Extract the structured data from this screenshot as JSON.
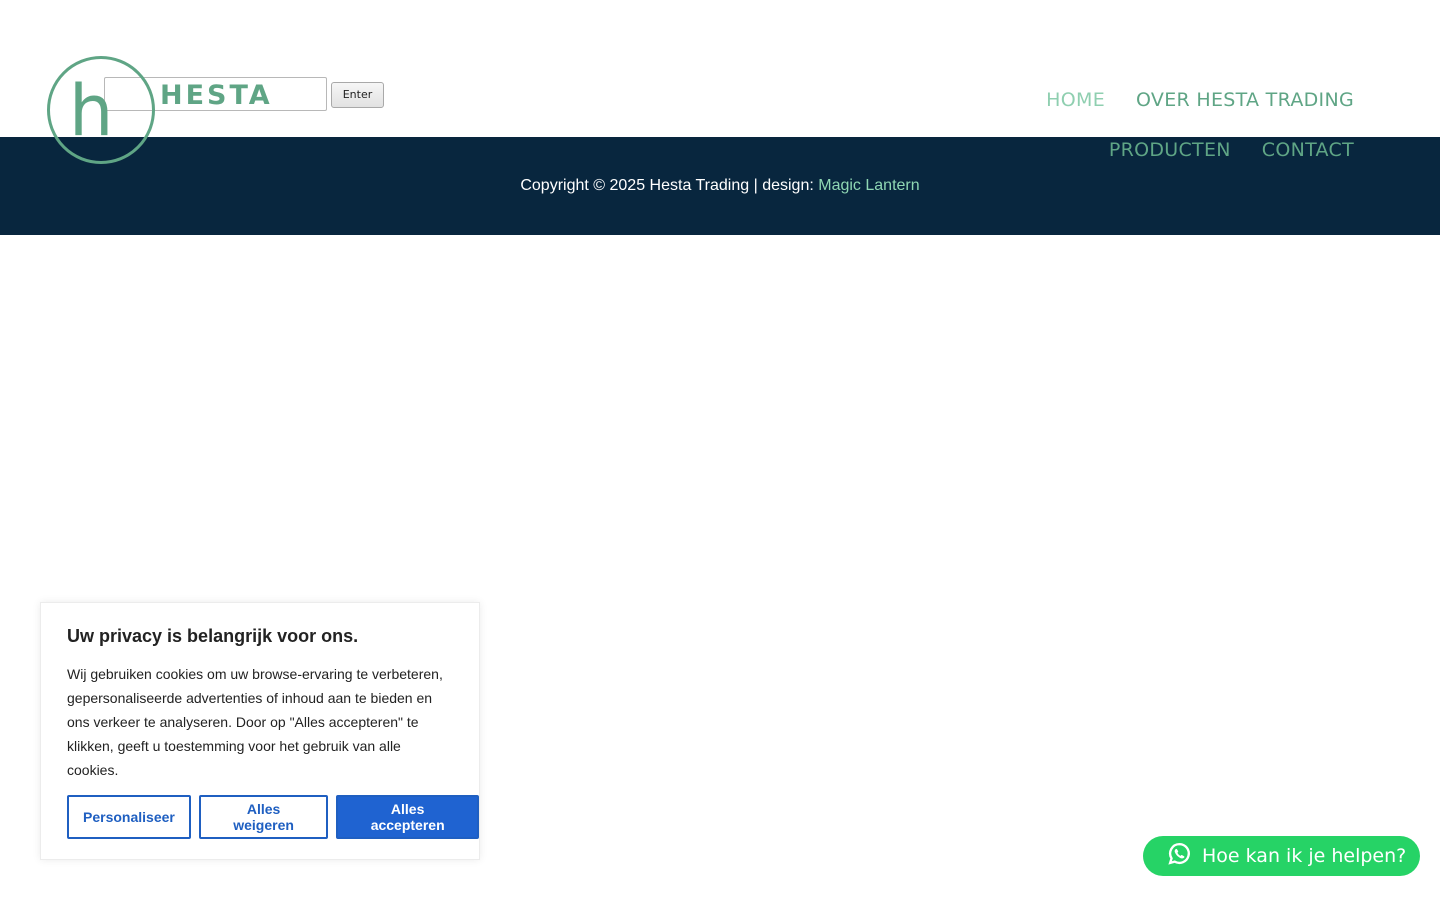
{
  "brand": {
    "logo_letter": "h",
    "logo_word": "HESTA",
    "accent_color": "#5fa585"
  },
  "search": {
    "button_label": "Enter",
    "placeholder": ""
  },
  "nav": {
    "items": [
      {
        "label": "HOME",
        "active": true
      },
      {
        "label": "OVER HESTA TRADING",
        "active": false
      },
      {
        "label": "PRODUCTEN",
        "active": false
      },
      {
        "label": "CONTACT",
        "active": false
      }
    ]
  },
  "footer": {
    "copyright": "Copyright © 2025 Hesta Trading | design:",
    "designer_link": "Magic Lantern",
    "background_color": "#08263e"
  },
  "cookie_banner": {
    "title": "Uw privacy is belangrijk voor ons.",
    "text": "Wij gebruiken cookies om uw browse-ervaring te verbeteren, gepersonaliseerde advertenties of inhoud aan te bieden en ons verkeer te analyseren. Door op \"Alles accepteren\" te klikken, geeft u toestemming voor het gebruik van alle cookies.",
    "buttons": {
      "customize": "Personaliseer",
      "reject": "Alles weigeren",
      "accept": "Alles accepteren"
    },
    "button_color": "#1f63d1"
  },
  "whatsapp": {
    "label": "Hoe kan ik je helpen?",
    "icon": "whatsapp-icon",
    "color": "#26d366"
  }
}
